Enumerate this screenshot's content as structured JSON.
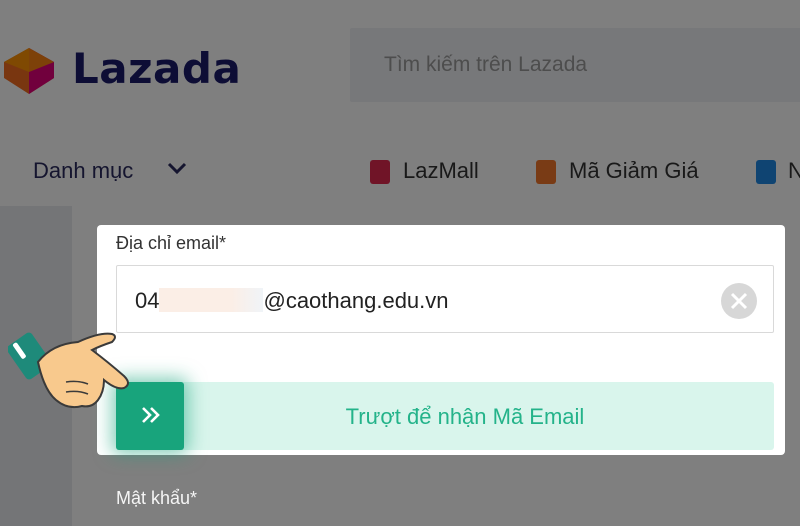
{
  "header": {
    "logo_text": "Lazada",
    "search_placeholder": "Tìm kiếm trên Lazada"
  },
  "nav": {
    "category_label": "Danh mục",
    "items": [
      {
        "label": "LazMall",
        "icon": "lazmall-icon",
        "color": "#e0294f"
      },
      {
        "label": "Mã Giảm Giá",
        "icon": "coupon-icon",
        "color": "#f2762a"
      },
      {
        "label": "N",
        "icon": "mobile-icon",
        "color": "#1e88e5"
      }
    ]
  },
  "form": {
    "email_label": "Địa chỉ email*",
    "email_value_prefix": "04",
    "email_value_suffix": "@caothang.edu.vn",
    "slider_label": "Trượt để nhận Mã Email",
    "password_label": "Mật khẩu*"
  },
  "colors": {
    "brand_navy": "#1a1a6b",
    "slider_bg": "#d9f5ec",
    "slider_handle": "#18a47c",
    "slider_text": "#24b38a"
  }
}
